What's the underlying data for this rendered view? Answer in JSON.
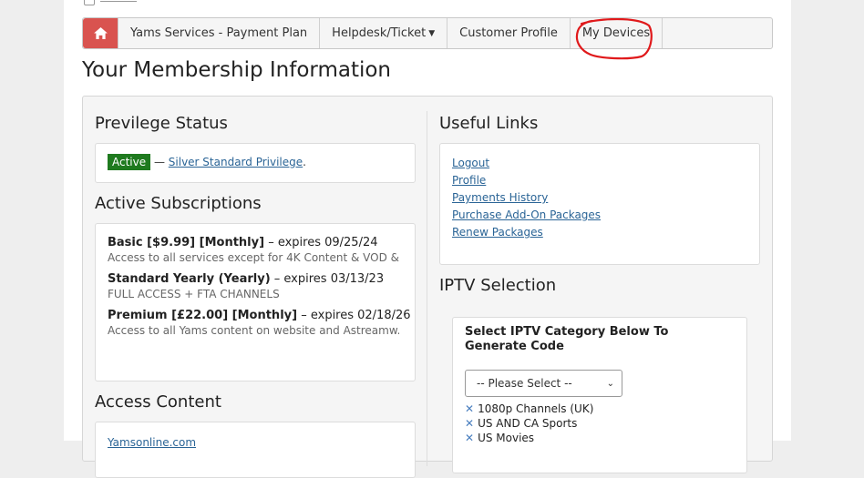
{
  "nav": {
    "items": [
      {
        "label": "Yams Services - Payment Plan"
      },
      {
        "label": "Helpdesk/Ticket"
      },
      {
        "label": "Customer Profile"
      },
      {
        "label": "My Devices"
      }
    ],
    "home_icon": "home-icon",
    "accent": "#d9534f"
  },
  "page": {
    "title": "Your Membership Information"
  },
  "privilege": {
    "heading": "Previlege Status",
    "badge": "Active",
    "separator": "—",
    "link": "Silver Standard Privilege",
    "trail": "."
  },
  "subscriptions": {
    "heading": "Active Subscriptions",
    "items": [
      {
        "name": "Basic [$9.99] [Monthly]",
        "expires": "– expires 09/25/24",
        "desc": "Access to all services except for 4K Content & VOD & ..."
      },
      {
        "name": "Standard Yearly (Yearly)",
        "expires": "– expires 03/13/23",
        "desc": "FULL ACCESS + FTA CHANNELS"
      },
      {
        "name": "Premium [£22.00] [Monthly]",
        "expires": "– expires 02/18/26",
        "desc": "Access to all Yams content on website and Astreamw..."
      }
    ]
  },
  "access": {
    "heading": "Access Content",
    "first_link": "Yamsonline.com"
  },
  "useful_links": {
    "heading": "Useful Links",
    "links": [
      "Logout",
      "Profile",
      "Payments History",
      "Purchase Add-On Packages",
      "Renew Packages"
    ]
  },
  "iptv": {
    "heading": "IPTV Selection",
    "prompt": "Select IPTV Category Below To Generate Code",
    "select_value": "-- Please Select --",
    "channels": [
      "1080p Channels (UK)",
      "US AND CA Sports",
      "US Movies"
    ]
  }
}
